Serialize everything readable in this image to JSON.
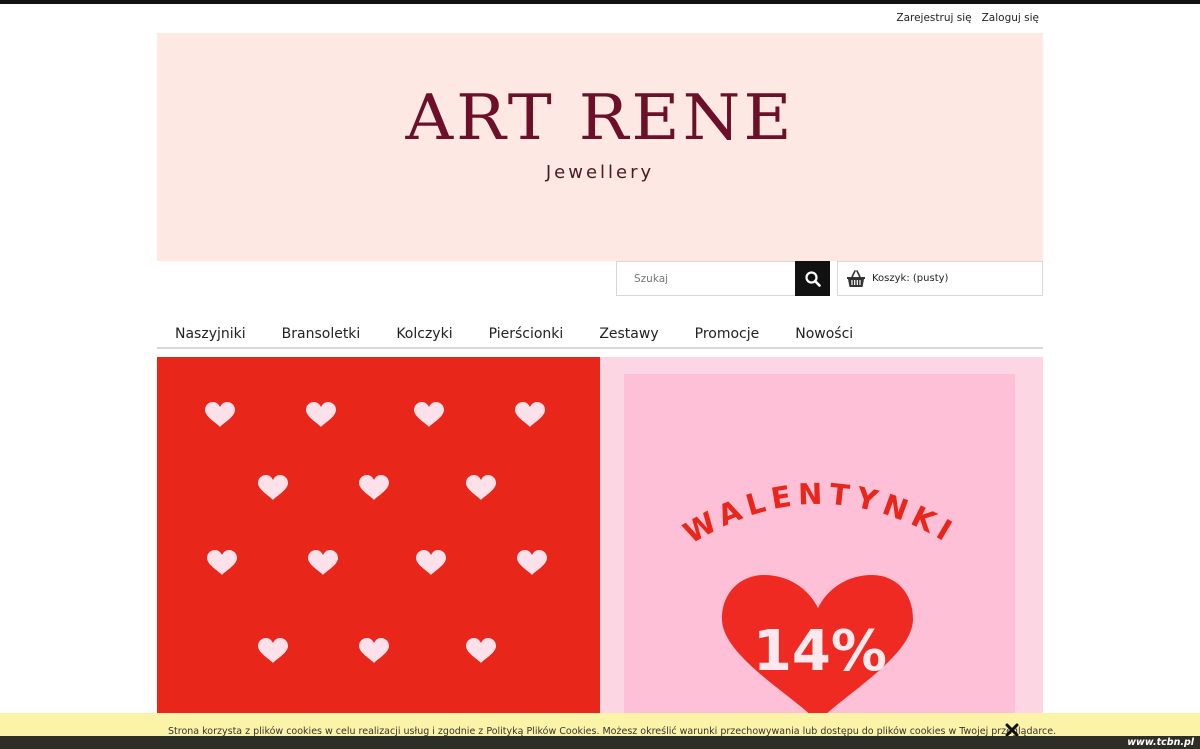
{
  "top_links": {
    "register": "Zarejestruj się",
    "login": "Zaloguj się"
  },
  "brand": {
    "name": "ART RENE",
    "tagline": "Jewellery",
    "color": "#6b1028",
    "banner_bg": "#fde8e4"
  },
  "search": {
    "placeholder": "Szukaj",
    "icon": "search-icon"
  },
  "cart": {
    "label": "Koszyk: (pusty)",
    "icon": "basket-icon"
  },
  "nav": {
    "items": [
      {
        "label": "Naszyjniki"
      },
      {
        "label": "Bransoletki"
      },
      {
        "label": "Kolczyki"
      },
      {
        "label": "Pierścionki"
      },
      {
        "label": "Zestawy"
      },
      {
        "label": "Promocje"
      },
      {
        "label": "Nowości"
      }
    ]
  },
  "promo": {
    "heading": "WALENTYNKI",
    "discount": "14%",
    "colors": {
      "left_bg": "#e9261a",
      "right_bg": "#fcd6e3",
      "card_bg": "#fdc0d6",
      "heart_light": "#fde1ea",
      "heart_red": "#ee2a22"
    }
  },
  "cookie": {
    "text": "Strona korzysta z plików cookies w celu realizacji usług i zgodnie z Polityką Plików Cookies. Możesz określić warunki przechowywania lub dostępu do plików cookies w Twojej przeglądarce.",
    "close_icon": "close-icon"
  },
  "watermark": "www.tcbn.pl"
}
